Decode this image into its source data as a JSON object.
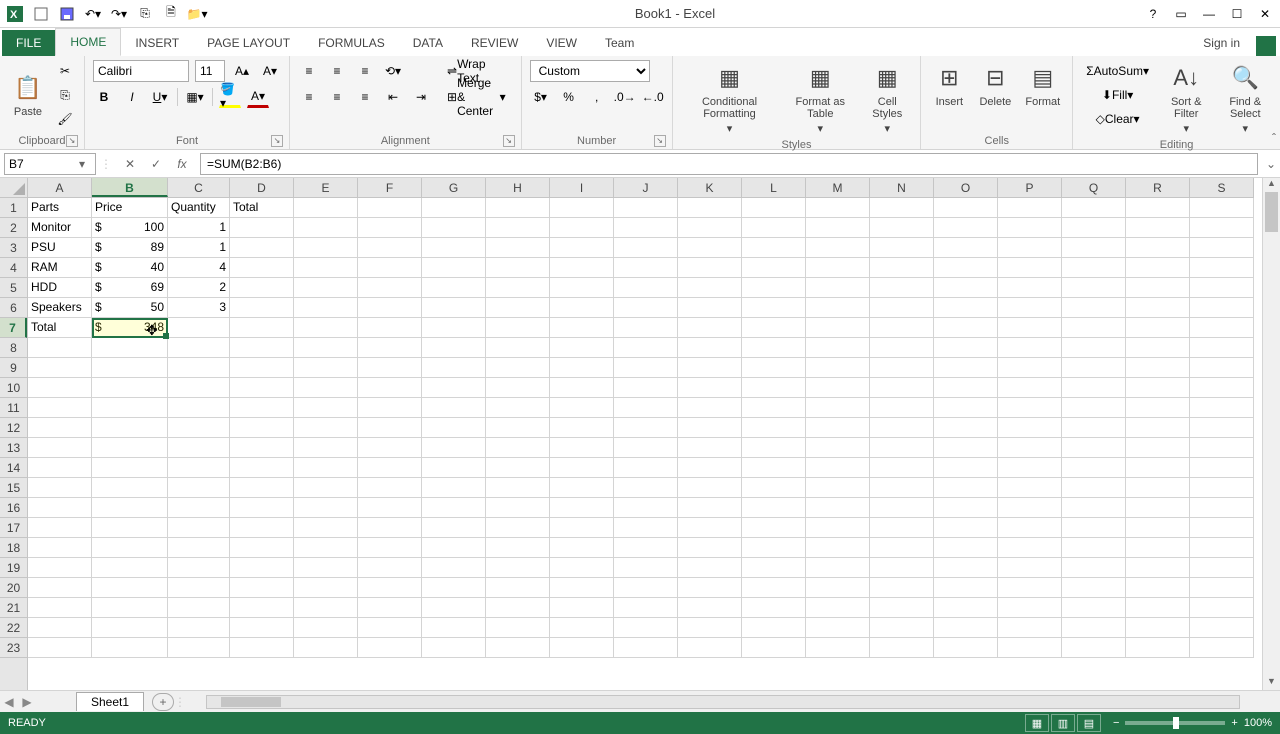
{
  "app": {
    "title": "Book1 - Excel"
  },
  "qat": {
    "save": "Save",
    "undo": "Undo",
    "redo": "Redo"
  },
  "tabs": [
    "FILE",
    "HOME",
    "INSERT",
    "PAGE LAYOUT",
    "FORMULAS",
    "DATA",
    "REVIEW",
    "VIEW",
    "Team"
  ],
  "active_tab": "HOME",
  "signin": "Sign in",
  "ribbon": {
    "clipboard": {
      "label": "Clipboard",
      "paste": "Paste",
      "cut": "Cut",
      "copy": "Copy",
      "fmtpaint": "Format Painter"
    },
    "font": {
      "label": "Font",
      "name": "Calibri",
      "size": "11"
    },
    "alignment": {
      "label": "Alignment",
      "wrap": "Wrap Text",
      "merge": "Merge & Center"
    },
    "number": {
      "label": "Number",
      "format": "Custom"
    },
    "styles": {
      "label": "Styles",
      "cond": "Conditional Formatting",
      "tbl": "Format as Table",
      "cell": "Cell Styles"
    },
    "cells": {
      "label": "Cells",
      "insert": "Insert",
      "delete": "Delete",
      "format": "Format"
    },
    "editing": {
      "label": "Editing",
      "sum": "AutoSum",
      "fill": "Fill",
      "clear": "Clear",
      "sort": "Sort & Filter",
      "find": "Find & Select"
    }
  },
  "namebox": "B7",
  "formula": "=SUM(B2:B6)",
  "columns": [
    "A",
    "B",
    "C",
    "D",
    "E",
    "F",
    "G",
    "H",
    "I",
    "J",
    "K",
    "L",
    "M",
    "N",
    "O",
    "P",
    "Q",
    "R",
    "S"
  ],
  "rows_visible": 23,
  "selected_col": "B",
  "selected_row": 7,
  "headers": {
    "A": "Parts",
    "B": "Price",
    "C": "Quantity",
    "D": "Total"
  },
  "data_rows": [
    {
      "part": "Monitor",
      "price": "100",
      "qty": "1"
    },
    {
      "part": "PSU",
      "price": "89",
      "qty": "1"
    },
    {
      "part": "RAM",
      "price": "40",
      "qty": "4"
    },
    {
      "part": "HDD",
      "price": "69",
      "qty": "2"
    },
    {
      "part": "Speakers",
      "price": "50",
      "qty": "3"
    }
  ],
  "total_row": {
    "label": "Total",
    "price": "348"
  },
  "currency_symbol": "$",
  "sheet": {
    "name": "Sheet1"
  },
  "status": {
    "ready": "READY",
    "zoom": "100%"
  }
}
